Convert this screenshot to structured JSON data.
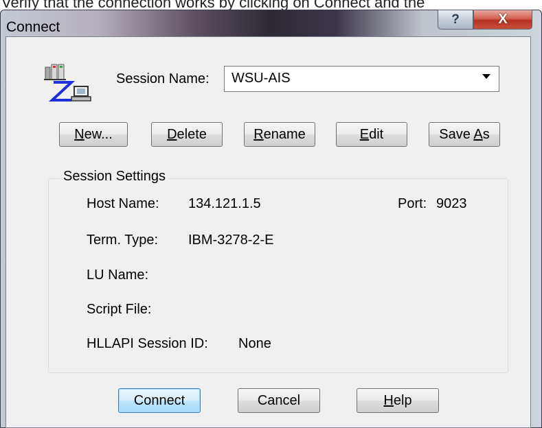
{
  "partial_text_above": "Verify that the connection works by clicking on Connect and the",
  "window": {
    "title": "Connect",
    "help_glyph": "?",
    "close_glyph": "X"
  },
  "session": {
    "label": "Session Name:",
    "value": "WSU-AIS"
  },
  "buttons": {
    "new": {
      "pre": "",
      "key": "N",
      "post": "ew..."
    },
    "delete": {
      "pre": "",
      "key": "D",
      "post": "elete"
    },
    "rename": {
      "pre": "",
      "key": "R",
      "post": "ename"
    },
    "edit": {
      "pre": "",
      "key": "E",
      "post": "dit"
    },
    "save_as": {
      "pre": "Save ",
      "key": "A",
      "post": "s"
    }
  },
  "settings": {
    "group_title": "Session Settings",
    "host_name_label": "Host Name:",
    "host_name_value": "134.121.1.5",
    "port_label": "Port:",
    "port_value": "9023",
    "term_type_label": "Term. Type:",
    "term_type_value": "IBM-3278-2-E",
    "lu_name_label": "LU Name:",
    "script_file_label": "Script File:",
    "hllapi_label": "HLLAPI Session ID:",
    "hllapi_value": "None"
  },
  "footer": {
    "connect": "Connect",
    "cancel": "Cancel",
    "help_key": "H",
    "help_post": "elp"
  },
  "colors": {
    "dialog_background": "#f0f0f0",
    "close_button": "#c8503c",
    "default_button_border": "#3c7fb1"
  }
}
